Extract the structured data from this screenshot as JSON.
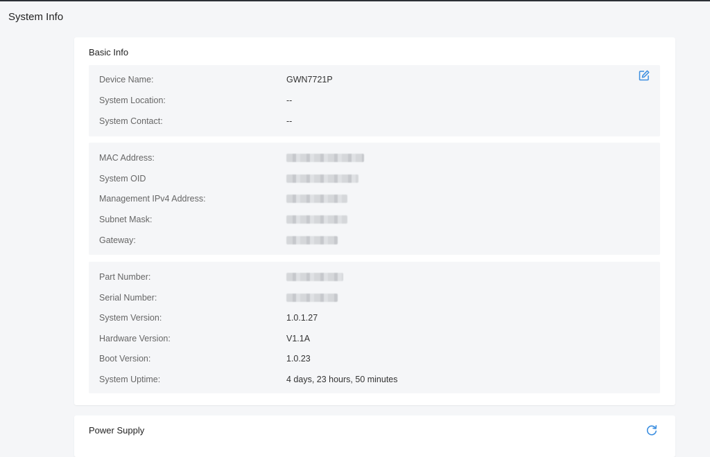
{
  "page": {
    "title": "System Info"
  },
  "basic_info": {
    "title": "Basic Info",
    "device_name": {
      "label": "Device Name:",
      "value": "GWN7721P"
    },
    "system_location": {
      "label": "System Location:",
      "value": "--"
    },
    "system_contact": {
      "label": "System Contact:",
      "value": "--"
    },
    "mac_address": {
      "label": "MAC Address:"
    },
    "system_oid": {
      "label": "System OID"
    },
    "mgmt_ipv4": {
      "label": "Management IPv4 Address:"
    },
    "subnet_mask": {
      "label": "Subnet Mask:"
    },
    "gateway": {
      "label": "Gateway:"
    },
    "part_number": {
      "label": "Part Number:"
    },
    "serial_number": {
      "label": "Serial Number:"
    },
    "system_version": {
      "label": "System Version:",
      "value": "1.0.1.27"
    },
    "hardware_version": {
      "label": "Hardware Version:",
      "value": "V1.1A"
    },
    "boot_version": {
      "label": "Boot Version:",
      "value": "1.0.23"
    },
    "system_uptime": {
      "label": "System Uptime:",
      "value": "4 days, 23 hours, 50 minutes"
    }
  },
  "power_supply": {
    "title": "Power Supply"
  },
  "icons": {
    "edit": "edit-icon",
    "refresh": "refresh-icon"
  },
  "colors": {
    "accent": "#3b8ee0",
    "group_bg": "#f5f6f8"
  }
}
